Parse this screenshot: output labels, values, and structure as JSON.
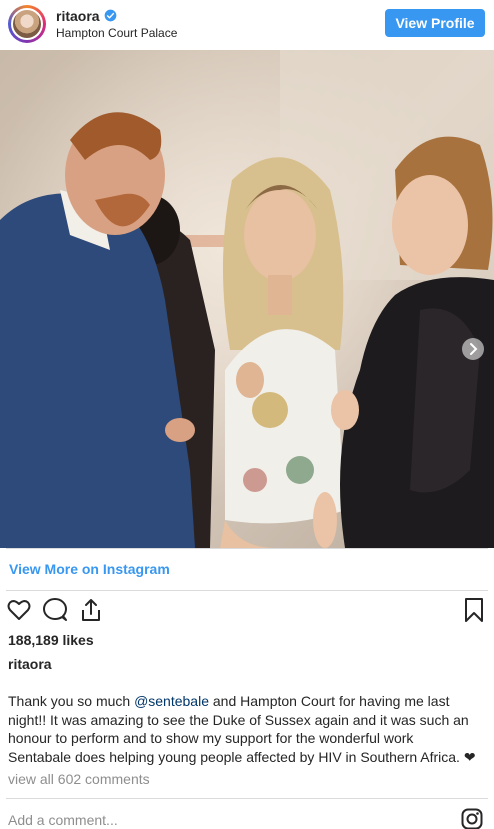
{
  "post": {
    "username": "ritaora",
    "location": "Hampton Court Palace",
    "view_profile_label": "View Profile",
    "view_more_label": "View More on Instagram",
    "likes": "188,189 likes",
    "caption_user": "ritaora",
    "caption_before": "Thank you so much ",
    "caption_mention": "@sentebale",
    "caption_after": " and Hampton Court for having me last night!! It was amazing to see the Duke of Sussex again and it was such an honour to perform and to show my support for the wonderful work Sentabale does helping young people affected by HIV in Southern Africa. ❤",
    "view_comments": "view all 602 comments",
    "add_comment_placeholder": "Add a comment..."
  },
  "icons": {
    "verified": "verified-badge-icon",
    "like": "heart-icon",
    "comment": "comment-bubble-icon",
    "share": "share-icon",
    "save": "bookmark-icon",
    "carousel_next": "chevron-right-icon",
    "instagram": "instagram-logo-icon"
  },
  "colors": {
    "accent": "#3897f0",
    "text": "#262626",
    "muted": "#8e8e8e",
    "mention": "#003569"
  }
}
